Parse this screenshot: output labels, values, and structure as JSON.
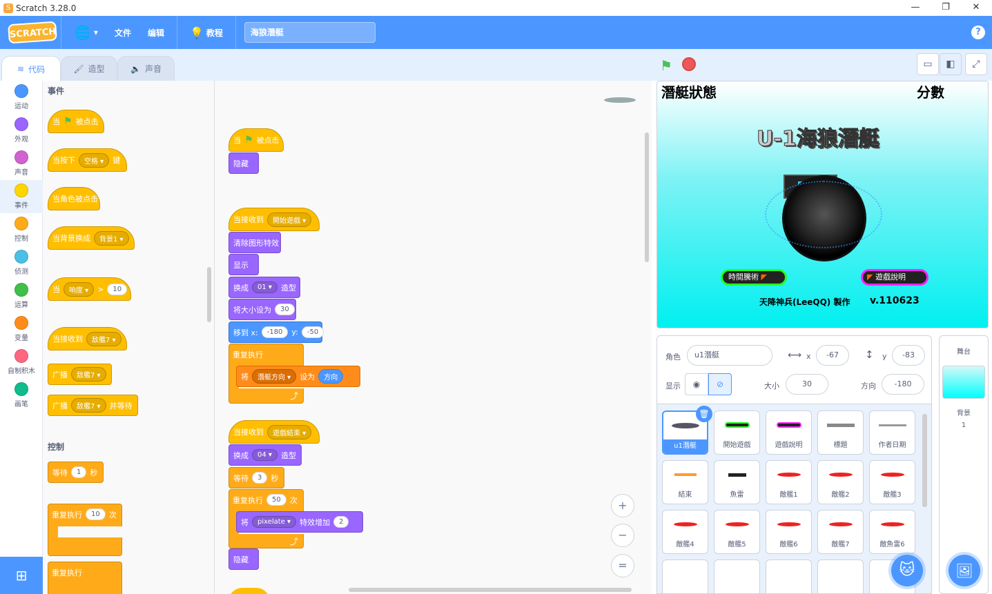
{
  "window": {
    "title": "Scratch 3.28.0",
    "min": "—",
    "max": "❐",
    "close": "✕"
  },
  "menu": {
    "logo": "SCRATCH",
    "lang_arrow": "▾",
    "file": "文件",
    "edit": "编辑",
    "tutorial": "教程",
    "project_title": "海狼潛艇",
    "help": "?"
  },
  "tabs": {
    "code": "代码",
    "costume": "造型",
    "sound": "声音"
  },
  "categories": [
    {
      "label": "运动",
      "color": "#4c97ff"
    },
    {
      "label": "外观",
      "color": "#9966ff"
    },
    {
      "label": "声音",
      "color": "#cf63cf"
    },
    {
      "label": "事件",
      "color": "#ffd500"
    },
    {
      "label": "控制",
      "color": "#ffab19"
    },
    {
      "label": "侦测",
      "color": "#4cbfe6"
    },
    {
      "label": "运算",
      "color": "#40bf4a"
    },
    {
      "label": "变量",
      "color": "#ff8c1a"
    },
    {
      "label": "自制积木",
      "color": "#ff6680"
    },
    {
      "label": "画笔",
      "color": "#0fbd8c"
    }
  ],
  "palette": {
    "events_title": "事件",
    "control_title": "控制",
    "when": "当",
    "clicked": "被点击",
    "when_key": "当按下",
    "key_space": "空格",
    "key": "键",
    "when_sprite_clicked": "当角色被点击",
    "when_backdrop": "当背景换成",
    "backdrop1": "背景1",
    "loudness": "响度",
    "gt": ">",
    "ten": "10",
    "when_receive": "当接收到",
    "enemy7": "敌艦7",
    "broadcast": "广播",
    "and_wait": "并等待",
    "wait": "等待",
    "one": "1",
    "sec": "秒",
    "repeat": "重复执行",
    "times": "次",
    "forever": "重复执行"
  },
  "script": {
    "when": "当",
    "clicked": "被点击",
    "hide": "隐藏",
    "when_receive": "当接收到",
    "msg_start": "開始遊戲",
    "clear_effects": "清除图形特效",
    "show": "显示",
    "switch": "换成",
    "costume01": "01",
    "costume": "造型",
    "set_size": "将大小设为",
    "size_val": "30",
    "goto_x": "移到 x:",
    "x_val": "-180",
    "y_label": "y:",
    "y_val": "-50",
    "forever": "重复执行",
    "set": "将",
    "var_dir": "潛艇方向",
    "set_to": "设为",
    "direction": "方向",
    "msg_end": "遊戲結束",
    "costume04": "04",
    "wait": "等待",
    "wait_val": "3",
    "sec": "秒",
    "repeat": "重复执行",
    "repeat_val": "50",
    "times": "次",
    "effect": "pixelate",
    "change_effect": "特效增加",
    "effect_val": "2",
    "loop_arrow": "⤴"
  },
  "zoom": {
    "in": "+",
    "out": "−",
    "reset": "="
  },
  "stage": {
    "status_label": "潛艇狀態",
    "score_label": "分數",
    "game_title": "U-1海狼潛艇",
    "btn_howto": "時間騰術",
    "btn_rules": "遊戲說明",
    "credits": "天降神兵(LeeQQ) 製作",
    "version": "v.110623"
  },
  "sprite_info": {
    "sprite_label": "角色",
    "sprite_name": "u1潛艇",
    "x_arrow": "⟷",
    "x_label": "x",
    "x_value": "-67",
    "y_arrow": "↕",
    "y_label": "y",
    "y_value": "-83",
    "show_label": "显示",
    "size_label": "大小",
    "size_value": "30",
    "dir_label": "方向",
    "dir_value": "-180"
  },
  "sprites": [
    "u1潛艇",
    "開始遊戲",
    "遊戲說明",
    "標題",
    "作者日期",
    "結束",
    "魚雷",
    "敵艦1",
    "敵艦2",
    "敵艦3",
    "敵艦4",
    "敵艦5",
    "敵艦6",
    "敵艦7",
    "敵魚雷6"
  ],
  "stage_panel": {
    "title": "舞台",
    "backdrops_label": "背景",
    "backdrops_count": "1"
  }
}
